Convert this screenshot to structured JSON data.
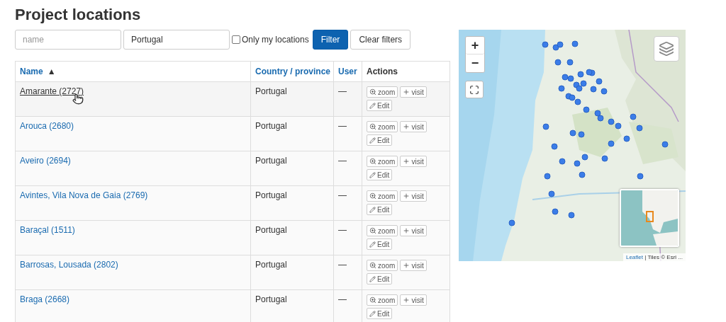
{
  "title": "Project locations",
  "filters": {
    "name": {
      "placeholder": "name"
    },
    "country": {
      "value": "Portugal"
    },
    "only_mine": {
      "label": "Only my locations",
      "checked": false
    },
    "buttons": [
      {
        "label": "Filter",
        "kind": "primary"
      },
      {
        "label": "Clear filters",
        "kind": "default"
      }
    ]
  },
  "table": {
    "columns": [
      {
        "label": "Name",
        "sort": "▲",
        "link": true
      },
      {
        "label": "Country / province",
        "link": true
      },
      {
        "label": "User",
        "link": true
      },
      {
        "label": "Actions",
        "link": false
      }
    ],
    "rows": [
      {
        "name": "Amarante (2727)",
        "country": "Portugal",
        "user": "—",
        "hovered": true,
        "actions": [
          "zoom",
          "visit",
          "Edit"
        ]
      },
      {
        "name": "Arouca (2680)",
        "country": "Portugal",
        "user": "—",
        "hovered": false,
        "actions": [
          "zoom",
          "visit",
          "Edit"
        ]
      },
      {
        "name": "Aveiro (2694)",
        "country": "Portugal",
        "user": "—",
        "hovered": false,
        "actions": [
          "zoom",
          "visit",
          "Edit"
        ]
      },
      {
        "name": "Avintes, Vila Nova de Gaia (2769)",
        "country": "Portugal",
        "user": "—",
        "hovered": false,
        "actions": [
          "zoom",
          "visit",
          "Edit"
        ]
      },
      {
        "name": "Baraçal (1511)",
        "country": "Portugal",
        "user": "—",
        "hovered": false,
        "actions": [
          "zoom",
          "visit",
          "Edit"
        ]
      },
      {
        "name": "Barrosas, Lousada (2802)",
        "country": "Portugal",
        "user": "—",
        "hovered": false,
        "actions": [
          "zoom",
          "visit",
          "Edit"
        ]
      },
      {
        "name": "Braga (2668)",
        "country": "Portugal",
        "user": "—",
        "hovered": false,
        "actions": [
          "zoom",
          "visit",
          "Edit"
        ]
      }
    ]
  },
  "map": {
    "zoom_in": "+",
    "zoom_out": "−",
    "attribution": {
      "link": "Leaflet",
      "text": "| Tiles © Esri ..."
    }
  }
}
